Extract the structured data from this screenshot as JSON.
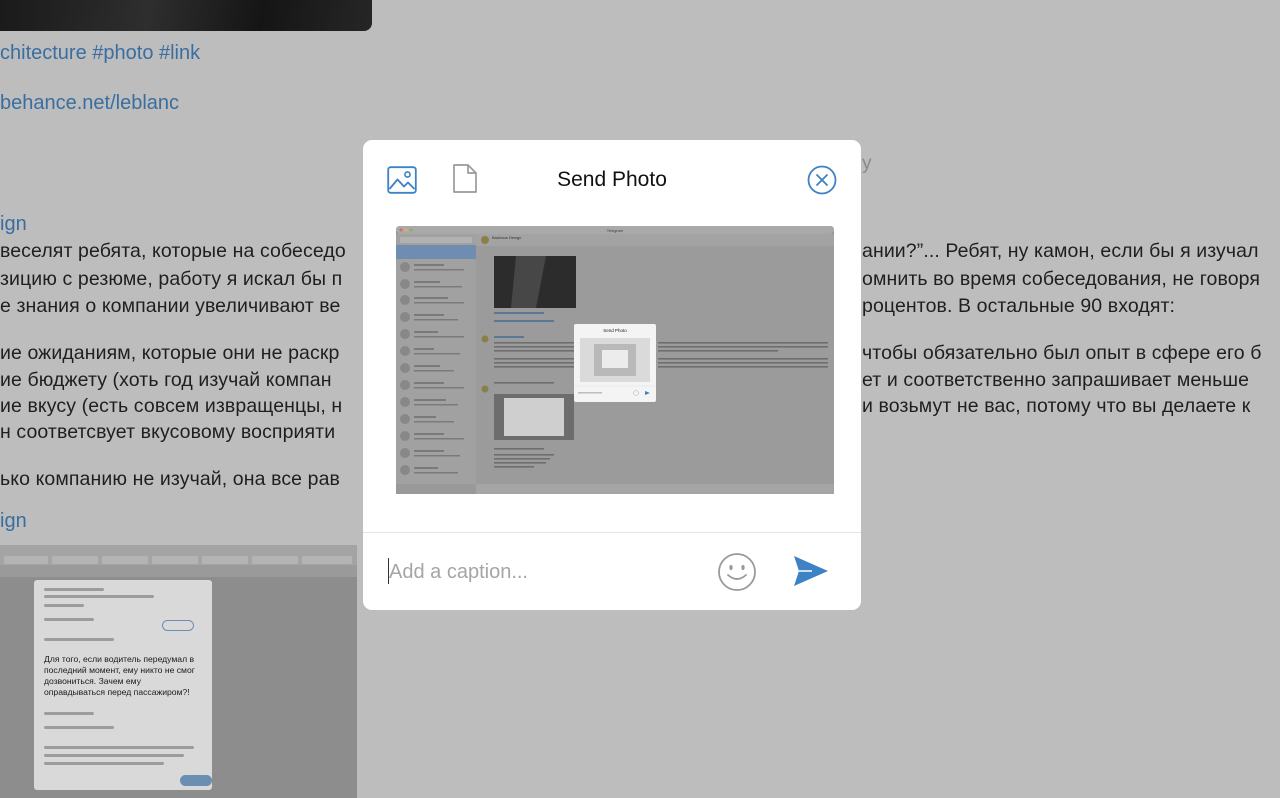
{
  "background": {
    "hashtags": "chitecture #photo #link",
    "link": "behance.net/leblanc",
    "faint_label": "y",
    "author_1": "ign",
    "author_2": "ign",
    "message_lines": [
      "веселят ребята, которые на собеседо",
      "зицию с резюме, работу я искал бы п",
      "е знания о компании увеличивают ве",
      "ие ожиданиям, которые они не раскр",
      "ие бюджету (хоть год изучай компан",
      "ие вкусу (есть совсем извращенцы, н",
      "н соответсвует вкусовому восприяти",
      "ько компанию не изучай, она все рав"
    ],
    "message_lines_right": [
      "ании?”... Ребят, ну камон, если бы я изучал",
      "омнить во время собеседования, не говоря",
      "роцентов. В остальные 90 входят:",
      "чтобы обязательно был опыт в сфере его б",
      "ет и соответственно запрашивает меньше",
      "и возьмут не вас, потому что вы делаете к"
    ],
    "tweet_text": "Для того, если водитель передумал в последний момент, ему никто не смог дозвониться. Зачем ему оправдываться перед пассажиром?!"
  },
  "modal": {
    "title": "Send Photo",
    "caption_placeholder": "Add a caption...",
    "icons": {
      "photo": "photo-icon",
      "file": "file-icon",
      "close": "close-circle-icon",
      "emoji": "emoji-icon",
      "send": "send-icon"
    },
    "preview": {
      "window_title": "Telegram",
      "chat_title": "Bauhaus Design",
      "nested_title": "Send Photo"
    }
  },
  "colors": {
    "accent": "#3d82c4",
    "icon_gray": "#9a9a9a",
    "overlay": "#bdbdbd"
  }
}
